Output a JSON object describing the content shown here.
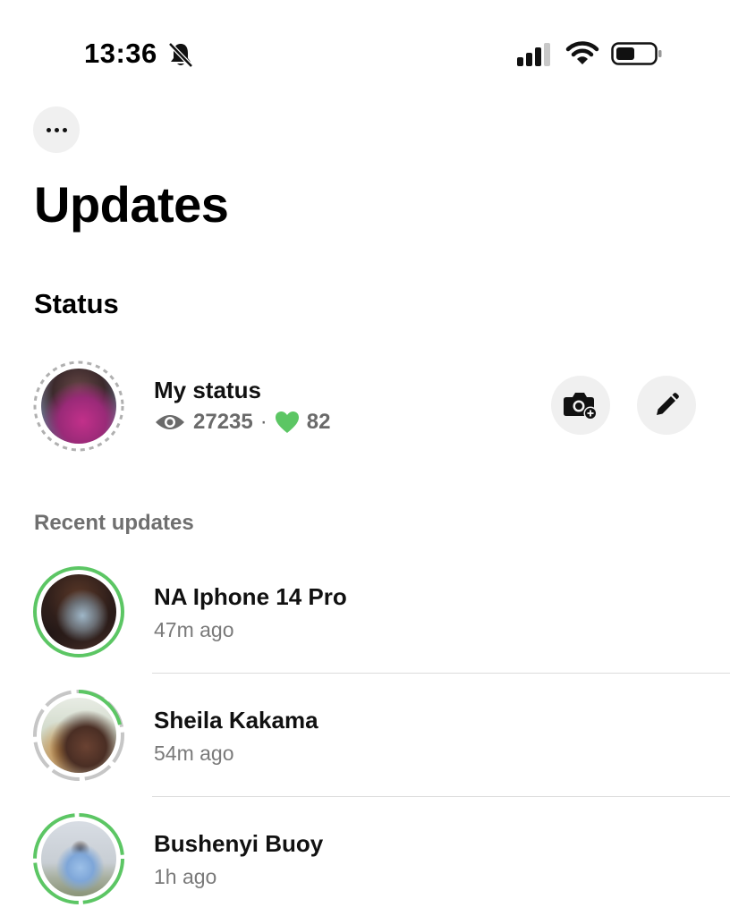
{
  "status_bar": {
    "time": "13:36",
    "icons": [
      "bell-slash-icon",
      "cellular-signal-icon",
      "wifi-icon",
      "battery-icon"
    ]
  },
  "header": {
    "more_icon": "ellipsis-icon",
    "title": "Updates"
  },
  "status_section": {
    "title": "Status",
    "my_status": {
      "name": "My status",
      "views": "27235",
      "separator": "·",
      "likes": "82",
      "actions": [
        "camera-add-icon",
        "pencil-icon"
      ]
    }
  },
  "recent_updates": {
    "label": "Recent updates",
    "items": [
      {
        "name": "NA Iphone 14 Pro",
        "time": "47m ago"
      },
      {
        "name": "Sheila Kakama",
        "time": "54m ago"
      },
      {
        "name": "Bushenyi Buoy",
        "time": "1h ago"
      }
    ]
  },
  "colors": {
    "accent_green": "#5cc664",
    "viewed_gray": "#c6c6c6",
    "button_bg": "#f0f0f0"
  }
}
